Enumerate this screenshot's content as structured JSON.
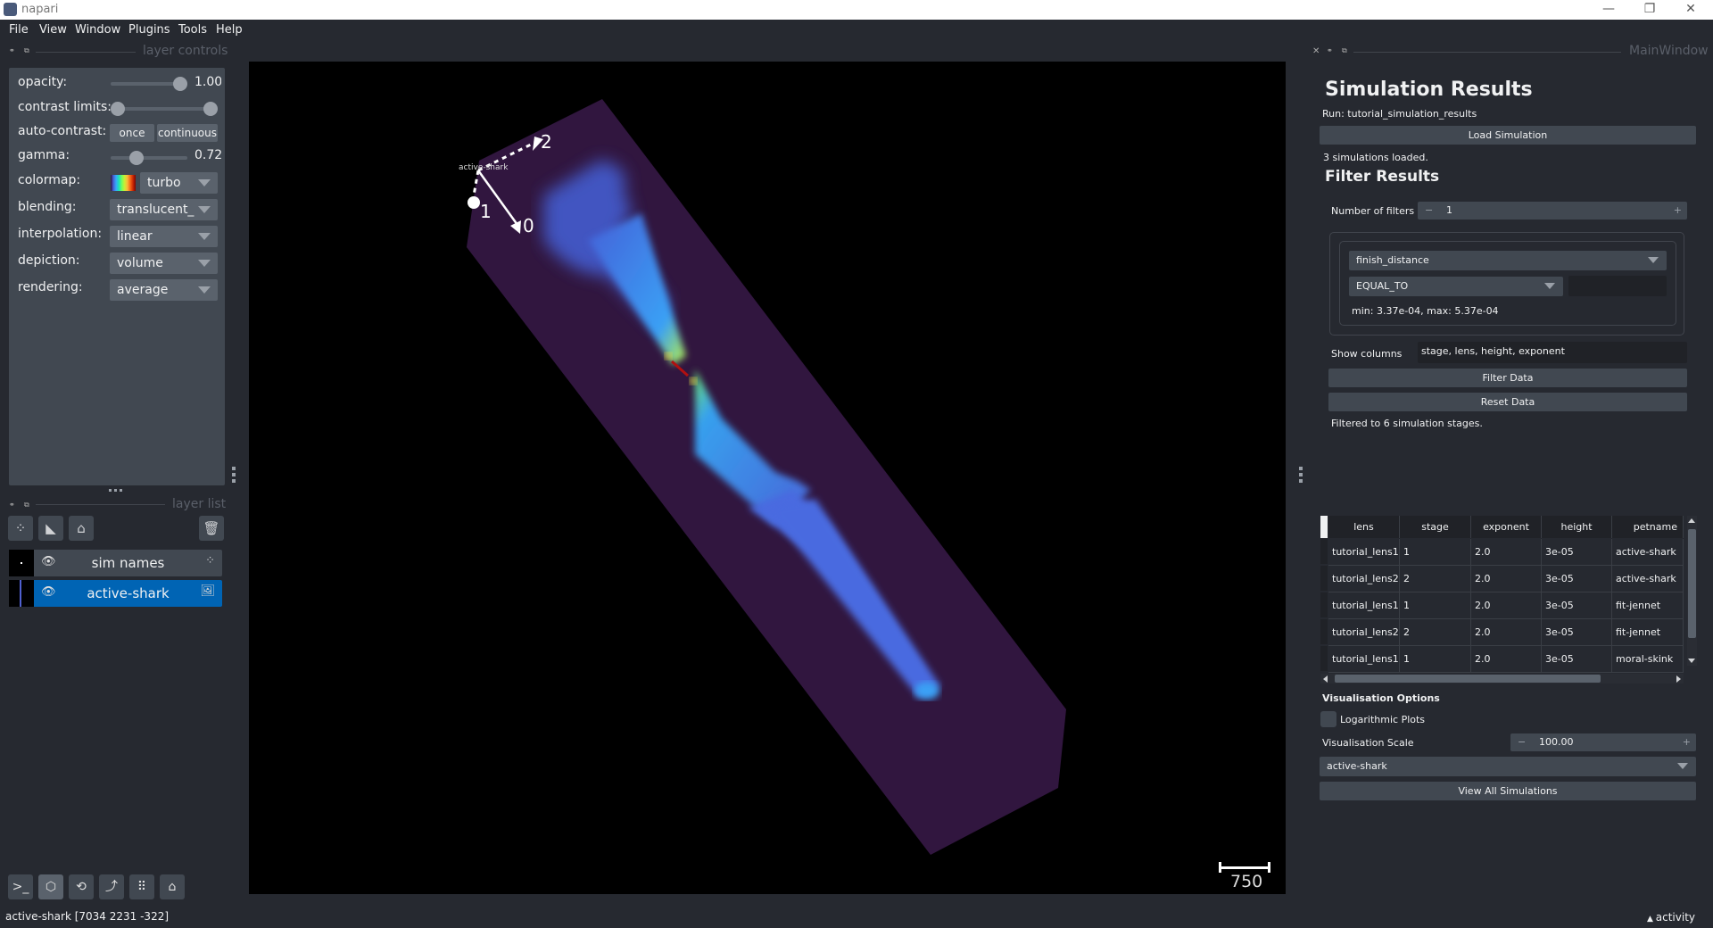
{
  "window": {
    "title": "napari",
    "minimize": "—",
    "restore": "❐",
    "close": "✕"
  },
  "menu": [
    "File",
    "View",
    "Window",
    "Plugins",
    "Tools",
    "Help"
  ],
  "docks": {
    "layer_controls_title": "layer controls",
    "layer_list_title": "layer list",
    "main_window_title": "MainWindow",
    "close_glyph": "✕",
    "float_glyph": "⧉",
    "hide_glyph": "◦"
  },
  "layer_controls": {
    "opacity": {
      "label": "opacity:",
      "value": "1.00",
      "fraction": 1.0
    },
    "contrast_limits": {
      "label": "contrast limits:",
      "low": 0.0,
      "high": 1.0
    },
    "auto_contrast": {
      "label": "auto-contrast:",
      "once": "once",
      "continuous": "continuous"
    },
    "gamma": {
      "label": "gamma:",
      "value": "0.72",
      "fraction": 0.36
    },
    "colormap": {
      "label": "colormap:",
      "value": "turbo"
    },
    "blending": {
      "label": "blending:",
      "value": "translucent_"
    },
    "interpolation": {
      "label": "interpolation:",
      "value": "linear"
    },
    "depiction": {
      "label": "depiction:",
      "value": "volume"
    },
    "rendering": {
      "label": "rendering:",
      "value": "average"
    }
  },
  "layer_list": {
    "tool_icons": [
      "points-icon",
      "shapes-icon",
      "labels-icon",
      "delete-icon"
    ],
    "layers": [
      {
        "name": "sim names",
        "type": "points",
        "selected": false
      },
      {
        "name": "active-shark",
        "type": "image",
        "selected": true
      }
    ]
  },
  "viewer_buttons": [
    "console",
    "ndisplay-3d",
    "roll-dims",
    "transpose-dims",
    "grid-view",
    "home"
  ],
  "canvas": {
    "point_labels": [
      "0",
      "1",
      "2"
    ],
    "text_label": "active-shark",
    "scale_bar": "750"
  },
  "status": {
    "text": "active-shark [7034 2231 -322]",
    "activity": "activity"
  },
  "sim_panel": {
    "title": "Simulation Results",
    "run": "Run: tutorial_simulation_results",
    "load_button": "Load Simulation",
    "loaded_msg": "3 simulations loaded.",
    "filter_title": "Filter Results",
    "num_filters_label": "Number of filters",
    "num_filters_value": "1",
    "filter": {
      "field": "finish_distance",
      "operator": "EQUAL_TO",
      "value": "",
      "range": "min: 3.37e-04, max: 5.37e-04"
    },
    "show_columns_label": "Show columns",
    "show_columns_value": "stage, lens, height, exponent",
    "filter_button": "Filter Data",
    "reset_button": "Reset Data",
    "filtered_msg": "Filtered to 6 simulation stages.",
    "table": {
      "columns": [
        "lens",
        "stage",
        "exponent",
        "height",
        "petname"
      ],
      "rows": [
        [
          "tutorial_lens1",
          "1",
          "2.0",
          "3e-05",
          "active-shark"
        ],
        [
          "tutorial_lens2",
          "2",
          "2.0",
          "3e-05",
          "active-shark"
        ],
        [
          "tutorial_lens1",
          "1",
          "2.0",
          "3e-05",
          "fit-jennet"
        ],
        [
          "tutorial_lens2",
          "2",
          "2.0",
          "3e-05",
          "fit-jennet"
        ],
        [
          "tutorial_lens1",
          "1",
          "2.0",
          "3e-05",
          "moral-skink"
        ]
      ]
    },
    "vis_title": "Visualisation Options",
    "log_plots_label": "Logarithmic Plots",
    "log_plots_checked": false,
    "vis_scale_label": "Visualisation Scale",
    "vis_scale_value": "100.00",
    "sim_select": "active-shark",
    "view_all_button": "View All Simulations"
  }
}
